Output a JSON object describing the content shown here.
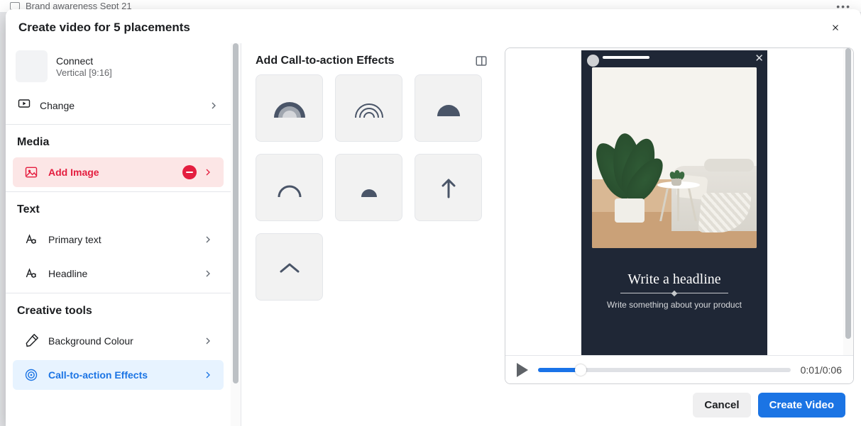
{
  "bg_row": {
    "label": "Brand awareness Sept 21"
  },
  "header": {
    "title": "Create video for 5 placements"
  },
  "sidebar": {
    "card": {
      "title": "Connect",
      "sub": "Vertical [9:16]"
    },
    "change": {
      "label": "Change"
    },
    "media": {
      "section": "Media",
      "add_image": "Add Image"
    },
    "text": {
      "section": "Text",
      "primary": "Primary text",
      "headline": "Headline"
    },
    "tools": {
      "section": "Creative tools",
      "bg": "Background Colour",
      "cta": "Call-to-action Effects"
    }
  },
  "center": {
    "title": "Add Call-to-action Effects"
  },
  "preview": {
    "headline": "Write a headline",
    "primary": "Write something about your product",
    "time": "0:01/0:06"
  },
  "footer": {
    "cancel": "Cancel",
    "create": "Create Video"
  },
  "colors": {
    "blue": "#1877f2",
    "red": "#e41e3f"
  }
}
